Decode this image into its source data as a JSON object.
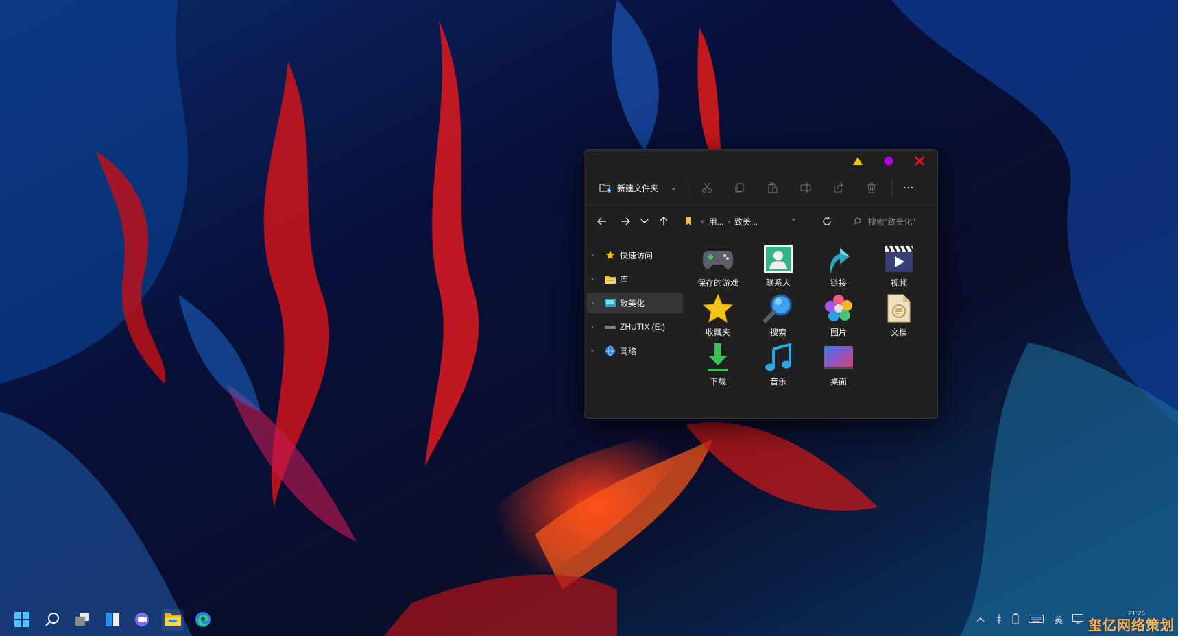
{
  "window": {
    "title_buttons": {
      "minimize": "triangle-yellow-icon",
      "maximize": "circle-purple-icon",
      "close": "x-red-icon"
    },
    "toolbar": {
      "new_label": "新建文件夹",
      "actions": [
        "cut-icon",
        "copy-icon",
        "paste-icon",
        "rename-icon",
        "share-icon",
        "delete-icon"
      ],
      "more_label": "⋯"
    },
    "nav": {
      "crumbs": [
        "用...",
        "致美..."
      ],
      "crumb_prefix": "«",
      "search_placeholder": "搜索\"致美化\""
    },
    "sidebar": [
      {
        "label": "快速访问",
        "icon": "star-icon"
      },
      {
        "label": "库",
        "icon": "library-folder-icon"
      },
      {
        "label": "致美化",
        "icon": "folder-teal-icon",
        "selected": true
      },
      {
        "label": "ZHUTIX (E:)",
        "icon": "drive-icon"
      },
      {
        "label": "网络",
        "icon": "network-icon"
      }
    ],
    "items": [
      {
        "label": "保存的游戏",
        "icon": "gamepad-icon"
      },
      {
        "label": "联系人",
        "icon": "contact-icon"
      },
      {
        "label": "链接",
        "icon": "link-arrow-icon"
      },
      {
        "label": "视频",
        "icon": "video-icon"
      },
      {
        "label": "收藏夹",
        "icon": "star-icon"
      },
      {
        "label": "搜索",
        "icon": "magnifier-icon"
      },
      {
        "label": "图片",
        "icon": "pictures-icon"
      },
      {
        "label": "文档",
        "icon": "document-icon"
      },
      {
        "label": "下载",
        "icon": "download-icon"
      },
      {
        "label": "音乐",
        "icon": "music-icon"
      },
      {
        "label": "桌面",
        "icon": "desktop-icon"
      }
    ]
  },
  "taskbar": {
    "apps": [
      "start-icon",
      "search-icon",
      "task-view-icon",
      "widgets-icon",
      "chat-icon",
      "file-explorer-icon",
      "edge-icon"
    ],
    "tray": {
      "lang": "英",
      "clock": "21:26"
    },
    "watermark": "玺亿网络策划"
  },
  "colors": {
    "window_bg": "#202020",
    "accent_yellow": "#f5c400",
    "accent_purple": "#b000e0",
    "accent_red": "#e81123"
  }
}
